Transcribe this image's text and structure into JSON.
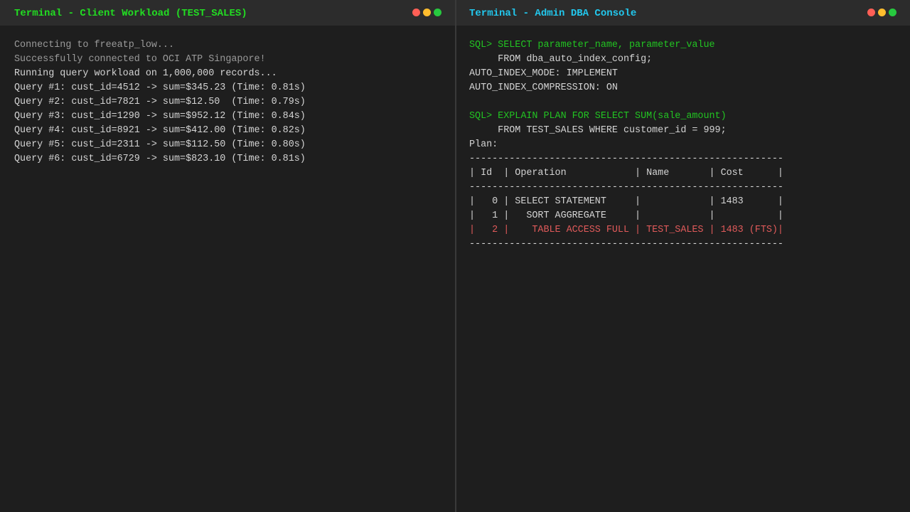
{
  "colors": {
    "background": "#1e1e1e",
    "titlebar": "#2c2c2c",
    "left_title": "#22dd22",
    "right_title": "#22c8ee",
    "dim_text": "#9a9a9a",
    "text": "#d4d4d4",
    "sql": "#22c422",
    "highlight": "#e05a5a",
    "dot_red": "#ff5f56",
    "dot_yellow": "#ffbd2e",
    "dot_green": "#27c93f"
  },
  "left_terminal": {
    "title": "Terminal - Client Workload (TEST_SALES)",
    "lines": [
      {
        "text": "Connecting to freeatp_low...",
        "style": "dim"
      },
      {
        "text": "Successfully connected to OCI ATP Singapore!",
        "style": "dim"
      },
      {
        "text": "Running query workload on 1,000,000 records...",
        "style": "normal"
      },
      {
        "text": "Query #1: cust_id=4512 -> sum=$345.23 (Time: 0.81s)",
        "style": "normal"
      },
      {
        "text": "Query #2: cust_id=7821 -> sum=$12.50  (Time: 0.79s)",
        "style": "normal"
      },
      {
        "text": "Query #3: cust_id=1290 -> sum=$952.12 (Time: 0.84s)",
        "style": "normal"
      },
      {
        "text": "Query #4: cust_id=8921 -> sum=$412.00 (Time: 0.82s)",
        "style": "normal"
      },
      {
        "text": "Query #5: cust_id=2311 -> sum=$112.50 (Time: 0.80s)",
        "style": "normal"
      },
      {
        "text": "Query #6: cust_id=6729 -> sum=$823.10 (Time: 0.81s)",
        "style": "normal"
      }
    ]
  },
  "right_terminal": {
    "title": "Terminal - Admin DBA Console",
    "lines": [
      {
        "text": "SQL> SELECT parameter_name, parameter_value",
        "style": "sql"
      },
      {
        "text": "     FROM dba_auto_index_config;",
        "style": "normal"
      },
      {
        "text": "AUTO_INDEX_MODE: IMPLEMENT",
        "style": "normal"
      },
      {
        "text": "AUTO_INDEX_COMPRESSION: ON",
        "style": "normal"
      },
      {
        "text": "",
        "style": "normal"
      },
      {
        "text": "SQL> EXPLAIN PLAN FOR SELECT SUM(sale_amount)",
        "style": "sql"
      },
      {
        "text": "     FROM TEST_SALES WHERE customer_id = 999;",
        "style": "normal"
      },
      {
        "text": "Plan:",
        "style": "normal"
      },
      {
        "text": "-------------------------------------------------------",
        "style": "normal"
      },
      {
        "text": "| Id  | Operation            | Name       | Cost      |",
        "style": "normal"
      },
      {
        "text": "-------------------------------------------------------",
        "style": "normal"
      },
      {
        "text": "|   0 | SELECT STATEMENT     |            | 1483      |",
        "style": "normal"
      },
      {
        "text": "|   1 |   SORT AGGREGATE     |            |           |",
        "style": "normal"
      },
      {
        "text": "|   2 |    TABLE ACCESS FULL | TEST_SALES | 1483 (FTS)|",
        "style": "highlight"
      },
      {
        "text": "-------------------------------------------------------",
        "style": "normal"
      }
    ]
  }
}
